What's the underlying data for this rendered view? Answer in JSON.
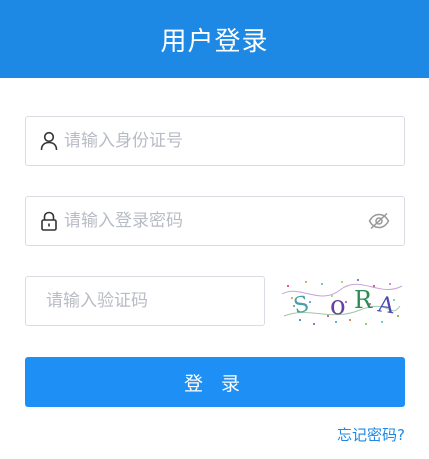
{
  "header": {
    "title": "用户登录"
  },
  "form": {
    "username_placeholder": "请输入身份证号",
    "password_placeholder": "请输入登录密码",
    "captcha_placeholder": "请输入验证码",
    "captcha_text": "SoRA",
    "submit_label": "登 录",
    "forgot_label": "忘记密码?"
  },
  "colors": {
    "brand": "#1e88e5",
    "button": "#1e90f5",
    "border": "#d9dde3",
    "placeholder": "#b8bcc4"
  },
  "icons": {
    "username": "user-icon",
    "password": "lock-icon",
    "visibility": "eye-off-icon"
  }
}
